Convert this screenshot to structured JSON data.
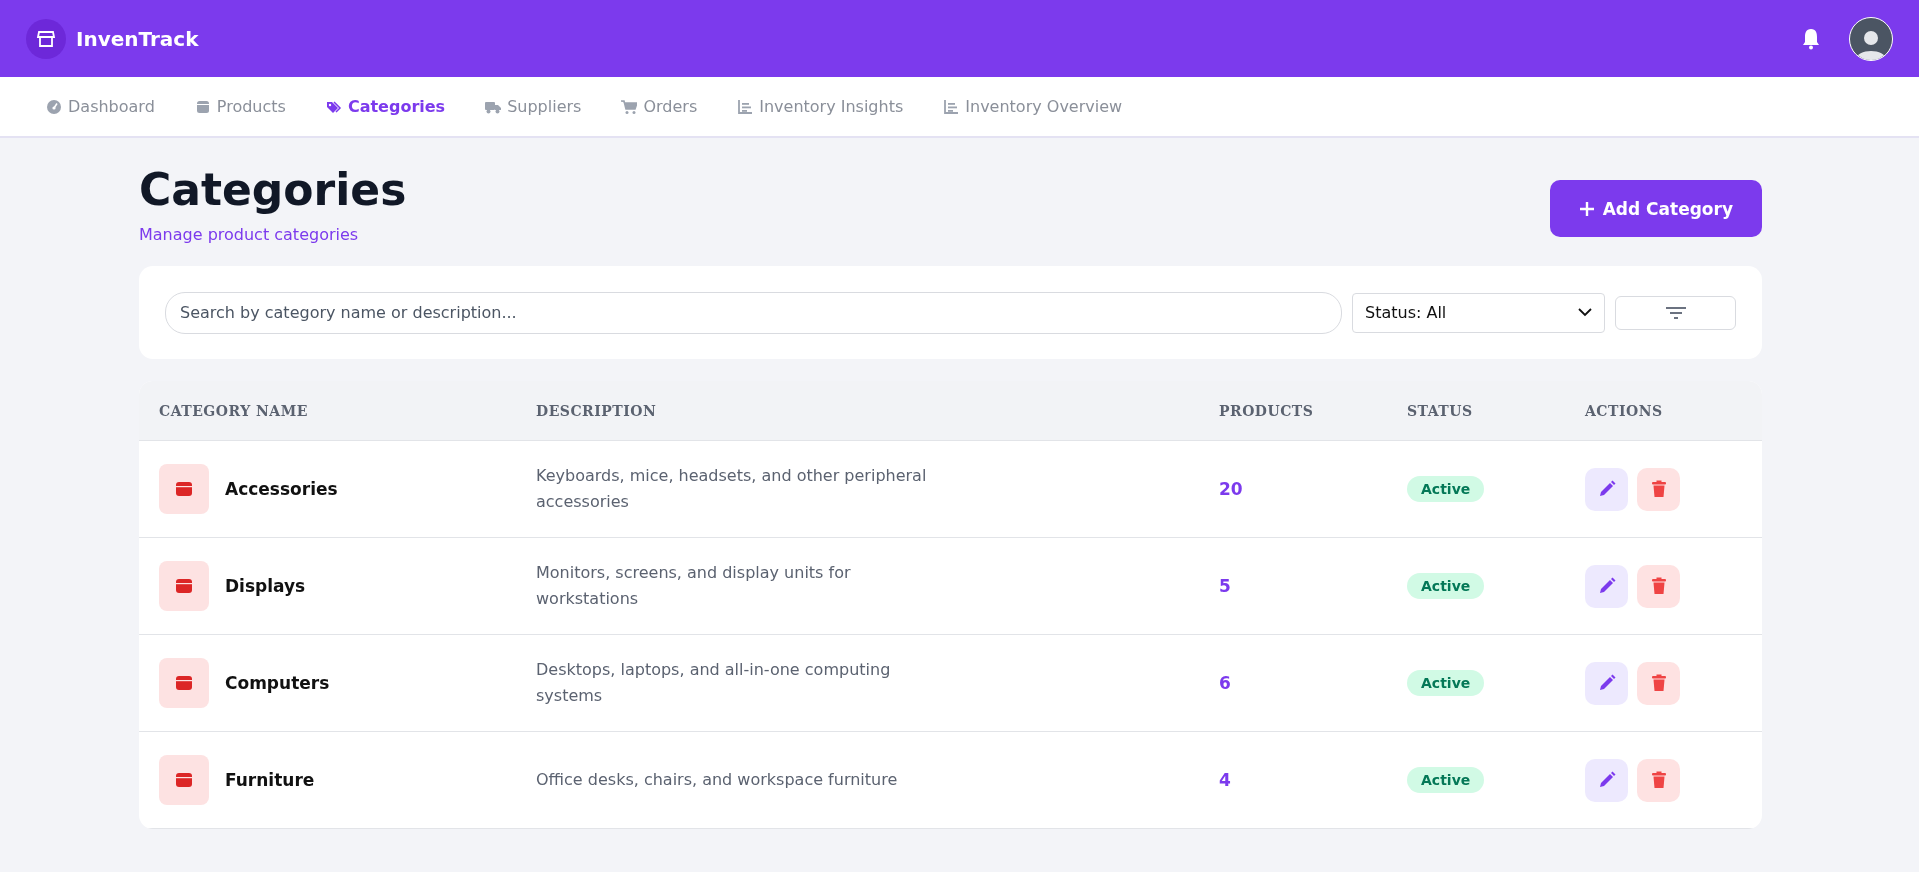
{
  "app": {
    "name": "InvenTrack"
  },
  "nav": [
    {
      "label": "Dashboard",
      "kind": "gauge",
      "selected": false
    },
    {
      "label": "Products",
      "kind": "box",
      "selected": false
    },
    {
      "label": "Categories",
      "kind": "tags",
      "selected": true
    },
    {
      "label": "Suppliers",
      "kind": "truck",
      "selected": false
    },
    {
      "label": "Orders",
      "kind": "cart",
      "selected": false
    },
    {
      "label": "Inventory Insights",
      "kind": "chart",
      "selected": false
    },
    {
      "label": "Inventory Overview",
      "kind": "chart",
      "selected": false
    }
  ],
  "page": {
    "title": "Categories",
    "subtitle": "Manage product categories",
    "add_button": "Add Category"
  },
  "filters": {
    "search": {
      "placeholder": "Search by category name or description..."
    },
    "status": {
      "value": "Status: All"
    }
  },
  "table": {
    "columns": [
      "CATEGORY NAME",
      "DESCRIPTION",
      "PRODUCTS",
      "STATUS",
      "ACTIONS"
    ],
    "rows": [
      {
        "name": "Accessories",
        "description": "Keyboards, mice, headsets, and other peripheral accessories",
        "products": "20",
        "status": "Active",
        "active": true
      },
      {
        "name": "Displays",
        "description": "Monitors, screens, and display units for workstations",
        "products": "5",
        "status": "Active",
        "active": true
      },
      {
        "name": "Computers",
        "description": "Desktops, laptops, and all-in-one computing systems",
        "products": "6",
        "status": "Active",
        "active": true
      },
      {
        "name": "Furniture",
        "description": "Office desks, chairs, and workspace furniture",
        "products": "4",
        "status": "Active",
        "active": true
      }
    ]
  }
}
